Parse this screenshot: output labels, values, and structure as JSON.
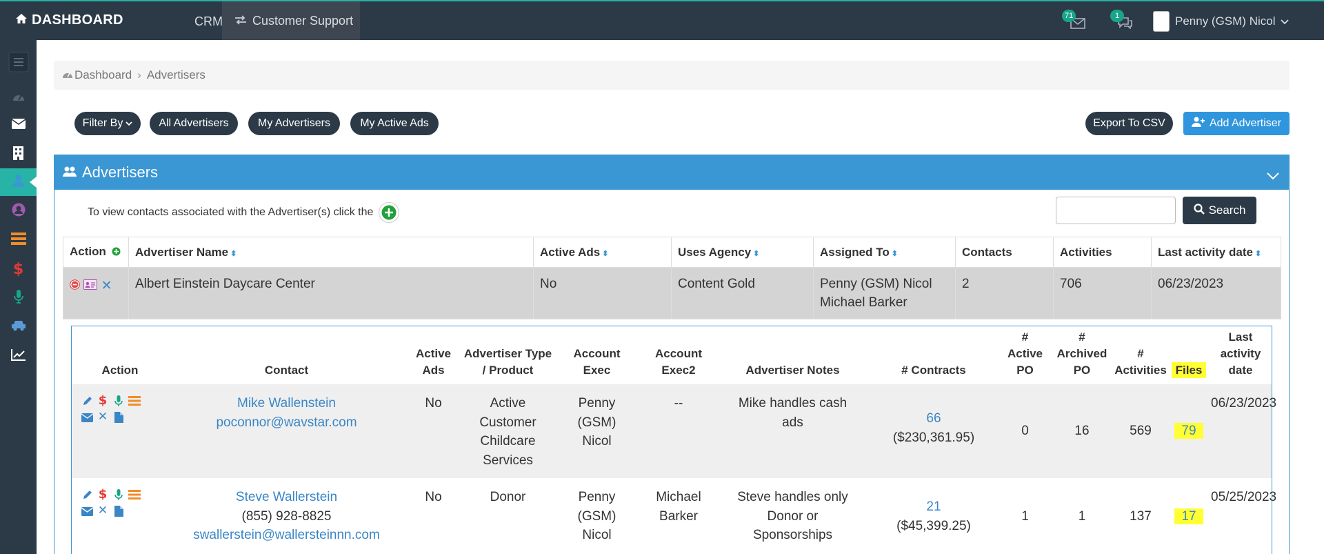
{
  "topbar": {
    "brand": "DASHBOARD",
    "crm": "CRM",
    "customer_support": "Customer Support",
    "mail_count": "71",
    "chat_count": "1",
    "user_name": "Penny (GSM) Nicol"
  },
  "breadcrumb": {
    "home": "Dashboard",
    "current": "Advertisers"
  },
  "filters": {
    "filter_by": "Filter By",
    "all": "All Advertisers",
    "mine": "My Advertisers",
    "active_ads": "My Active Ads",
    "export": "Export To CSV",
    "add": "Add Advertiser"
  },
  "panel": {
    "title": "Advertisers",
    "hint": "To view contacts associated with the Advertiser(s) click the",
    "search_value": "",
    "search_label": "Search"
  },
  "outer_table": {
    "headers": [
      "Action",
      "Advertiser Name",
      "Active Ads",
      "Uses Agency",
      "Assigned To",
      "Contacts",
      "Activities",
      "Last activity date"
    ],
    "row": {
      "name": "Albert Einstein Daycare Center",
      "active_ads": "No",
      "uses_agency": "Content Gold",
      "assigned_1": "Penny (GSM) Nicol",
      "assigned_2": "Michael Barker",
      "contacts": "2",
      "activities": "706",
      "last_date": "06/23/2023"
    }
  },
  "inner_table": {
    "headers": {
      "action": "Action",
      "contact": "Contact",
      "active_ads_1": "Active",
      "active_ads_2": "Ads",
      "adv_type_1": "Advertiser Type",
      "adv_type_2": "/ Product",
      "acct_exec_1": "Account",
      "acct_exec_2": "Exec",
      "acct_exec2_1": "Account",
      "acct_exec2_2": "Exec2",
      "notes": "Advertiser Notes",
      "contracts": "# Contracts",
      "active_po_1": "#",
      "active_po_2": "Active",
      "active_po_3": "PO",
      "archived_po_1": "#",
      "archived_po_2": "Archived",
      "archived_po_3": "PO",
      "activities_1": "#",
      "activities_2": "Activities",
      "files": "Files",
      "last_date_1": "Last activity",
      "last_date_2": "date"
    },
    "rows": [
      {
        "name": "Mike Wallenstein",
        "phone": "",
        "email": "poconnor@wavstar.com",
        "active_ads": "No",
        "type_1": "Active",
        "type_2": "Customer",
        "type_3": "Childcare",
        "type_4": "Services",
        "exec_1": "Penny",
        "exec_2": "(GSM)",
        "exec_3": "Nicol",
        "exec2_1": "--",
        "exec2_2": "",
        "notes_1": "Mike handles cash",
        "notes_2": "ads",
        "notes_3": "",
        "contracts": "66",
        "contracts_amount": "($230,361.95)",
        "active_po": "0",
        "archived_po": "16",
        "activities": "569",
        "files": "79",
        "last_date": "06/23/2023"
      },
      {
        "name": "Steve Wallerstein",
        "phone": "(855) 928-8825",
        "email": "swallerstein@wallersteinnn.com",
        "active_ads": "No",
        "type_1": "Donor",
        "type_2": "",
        "type_3": "",
        "type_4": "",
        "exec_1": "Penny",
        "exec_2": "(GSM)",
        "exec_3": "Nicol",
        "exec2_1": "Michael",
        "exec2_2": "Barker",
        "notes_1": "Steve handles only",
        "notes_2": "Donor or",
        "notes_3": "Sponsorships",
        "contracts": "21",
        "contracts_amount": "($45,399.25)",
        "active_po": "1",
        "archived_po": "1",
        "activities": "137",
        "files": "17",
        "last_date": "05/25/2023"
      }
    ]
  },
  "colors": {
    "navbar": "#2c3a47",
    "panel_header": "#3a97d4",
    "accent_teal": "#27b3a6",
    "link": "#3a86c6",
    "highlight": "#ffff33"
  }
}
